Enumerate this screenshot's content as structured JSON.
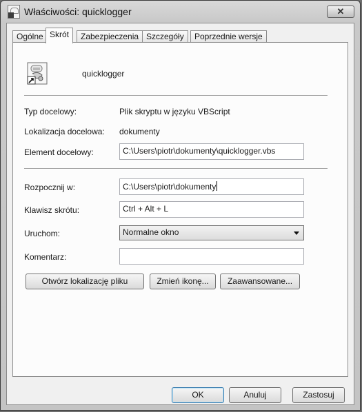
{
  "window": {
    "title": "Właściwości: quicklogger",
    "close_glyph": "✕"
  },
  "tabs": [
    {
      "label": "Ogólne",
      "active": false
    },
    {
      "label": "Skrót",
      "active": true
    },
    {
      "label": "Zabezpieczenia",
      "active": false
    },
    {
      "label": "Szczegóły",
      "active": false
    },
    {
      "label": "Poprzednie wersje",
      "active": false
    }
  ],
  "file": {
    "name": "quicklogger",
    "icon": "vbscript-shortcut-icon"
  },
  "props": {
    "target_type_label": "Typ docelowy:",
    "target_type_value": "Plik skryptu w języku VBScript",
    "target_location_label": "Lokalizacja docelowa:",
    "target_location_value": "dokumenty",
    "target_label": "Element docelowy:",
    "target_value": "C:\\Users\\piotr\\dokumenty\\quicklogger.vbs",
    "start_in_label": "Rozpocznij w:",
    "start_in_value": "C:\\Users\\piotr\\dokumenty",
    "shortcut_key_label": "Klawisz skrótu:",
    "shortcut_key_value": "Ctrl + Alt + L",
    "run_label": "Uruchom:",
    "run_value": "Normalne okno",
    "comment_label": "Komentarz:",
    "comment_value": ""
  },
  "buttons": {
    "open_location": "Otwórz lokalizację pliku",
    "change_icon": "Zmień ikonę...",
    "advanced": "Zaawansowane..."
  },
  "footer": {
    "ok": "OK",
    "cancel": "Anuluj",
    "apply": "Zastosuj"
  }
}
